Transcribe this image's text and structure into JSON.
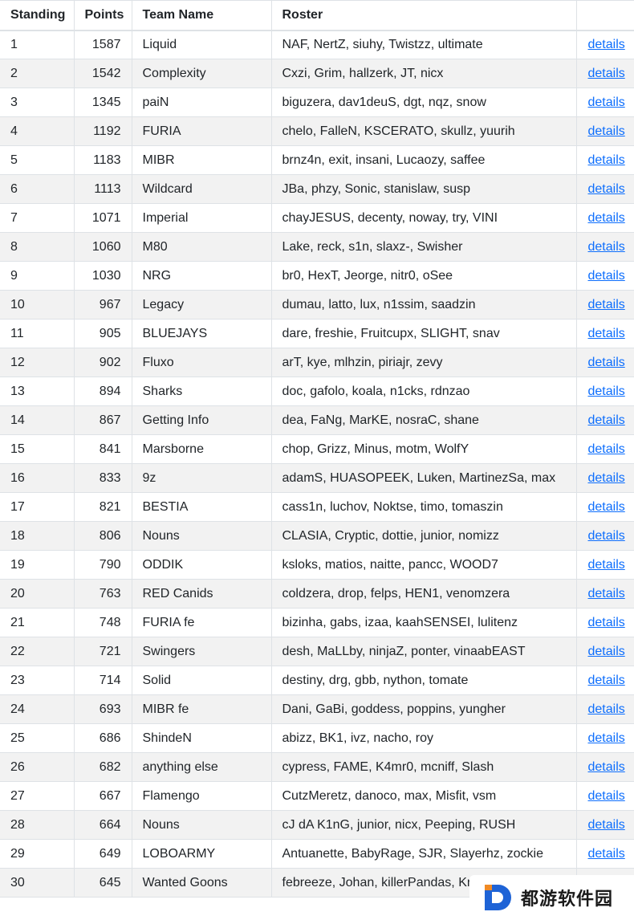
{
  "columns": {
    "standing": "Standing",
    "points": "Points",
    "team": "Team Name",
    "roster": "Roster",
    "link": ""
  },
  "link_label": "details",
  "colors": {
    "link": "#0d6efd",
    "stripe": "#f2f2f2",
    "border": "#dee2e6"
  },
  "rows": [
    {
      "standing": "1",
      "points": "1587",
      "team": "Liquid",
      "roster": "NAF, NertZ, siuhy, Twistzz, ultimate"
    },
    {
      "standing": "2",
      "points": "1542",
      "team": "Complexity",
      "roster": "Cxzi, Grim, hallzerk, JT, nicx"
    },
    {
      "standing": "3",
      "points": "1345",
      "team": "paiN",
      "roster": "biguzera, dav1deuS, dgt, nqz, snow"
    },
    {
      "standing": "4",
      "points": "1192",
      "team": "FURIA",
      "roster": "chelo, FalleN, KSCERATO, skullz, yuurih"
    },
    {
      "standing": "5",
      "points": "1183",
      "team": "MIBR",
      "roster": "brnz4n, exit, insani, Lucaozy, saffee"
    },
    {
      "standing": "6",
      "points": "1113",
      "team": "Wildcard",
      "roster": "JBa, phzy, Sonic, stanislaw, susp"
    },
    {
      "standing": "7",
      "points": "1071",
      "team": "Imperial",
      "roster": "chayJESUS, decenty, noway, try, VINI"
    },
    {
      "standing": "8",
      "points": "1060",
      "team": "M80",
      "roster": "Lake, reck, s1n, slaxz-, Swisher"
    },
    {
      "standing": "9",
      "points": "1030",
      "team": "NRG",
      "roster": "br0, HexT, Jeorge, nitr0, oSee"
    },
    {
      "standing": "10",
      "points": "967",
      "team": "Legacy",
      "roster": "dumau, latto, lux, n1ssim, saadzin"
    },
    {
      "standing": "11",
      "points": "905",
      "team": "BLUEJAYS",
      "roster": "dare, freshie, Fruitcupx, SLIGHT, snav"
    },
    {
      "standing": "12",
      "points": "902",
      "team": "Fluxo",
      "roster": "arT, kye, mlhzin, piriajr, zevy"
    },
    {
      "standing": "13",
      "points": "894",
      "team": "Sharks",
      "roster": "doc, gafolo, koala, n1cks, rdnzao"
    },
    {
      "standing": "14",
      "points": "867",
      "team": "Getting Info",
      "roster": "dea, FaNg, MarKE, nosraC, shane"
    },
    {
      "standing": "15",
      "points": "841",
      "team": "Marsborne",
      "roster": "chop, Grizz, Minus, motm, WolfY"
    },
    {
      "standing": "16",
      "points": "833",
      "team": "9z",
      "roster": "adamS, HUASOPEEK, Luken, MartinezSa, max"
    },
    {
      "standing": "17",
      "points": "821",
      "team": "BESTIA",
      "roster": "cass1n, luchov, Noktse, timo, tomaszin"
    },
    {
      "standing": "18",
      "points": "806",
      "team": "Nouns",
      "roster": "CLASIA, Cryptic, dottie, junior, nomizz"
    },
    {
      "standing": "19",
      "points": "790",
      "team": "ODDIK",
      "roster": "ksloks, matios, naitte, pancc, WOOD7"
    },
    {
      "standing": "20",
      "points": "763",
      "team": "RED Canids",
      "roster": "coldzera, drop, felps, HEN1, venomzera"
    },
    {
      "standing": "21",
      "points": "748",
      "team": "FURIA fe",
      "roster": "bizinha, gabs, izaa, kaahSENSEI, lulitenz"
    },
    {
      "standing": "22",
      "points": "721",
      "team": "Swingers",
      "roster": "desh, MaLLby, ninjaZ, ponter, vinaabEAST"
    },
    {
      "standing": "23",
      "points": "714",
      "team": "Solid",
      "roster": "destiny, drg, gbb, nython, tomate"
    },
    {
      "standing": "24",
      "points": "693",
      "team": "MIBR fe",
      "roster": "Dani, GaBi, goddess, poppins, yungher"
    },
    {
      "standing": "25",
      "points": "686",
      "team": "ShindeN",
      "roster": "abizz, BK1, ivz, nacho, roy"
    },
    {
      "standing": "26",
      "points": "682",
      "team": "anything else",
      "roster": "cypress, FAME, K4mr0, mcniff, Slash"
    },
    {
      "standing": "27",
      "points": "667",
      "team": "Flamengo",
      "roster": "CutzMeretz, danoco, max, Misfit, vsm"
    },
    {
      "standing": "28",
      "points": "664",
      "team": "Nouns",
      "roster": "cJ dA K1nG, junior, nicx, Peeping, RUSH"
    },
    {
      "standing": "29",
      "points": "649",
      "team": "LOBOARMY",
      "roster": "Antuanette, BabyRage, SJR, Slayerhz, zockie"
    },
    {
      "standing": "30",
      "points": "645",
      "team": "Wanted Goons",
      "roster": "febreeze, Johan, killerPandas, KmZ"
    }
  ],
  "watermark": {
    "text": "都游软件园",
    "icon": "d-logo-icon"
  }
}
